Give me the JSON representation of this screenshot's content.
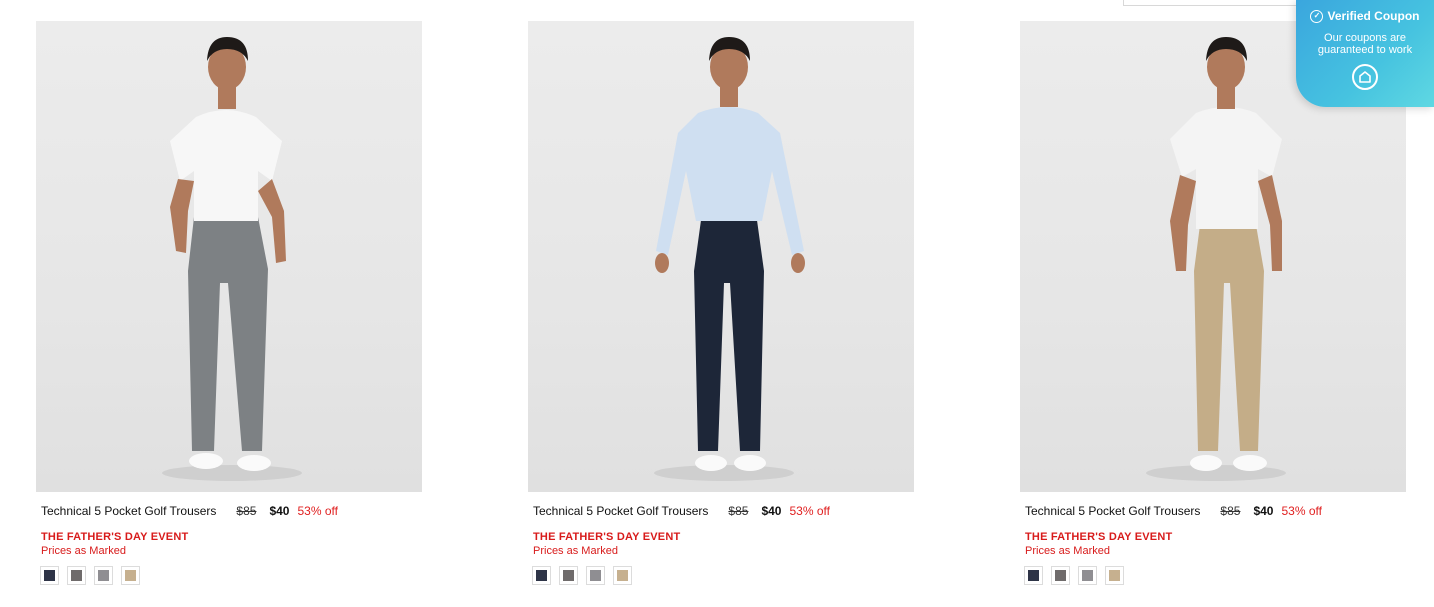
{
  "products": [
    {
      "title": "Technical 5 Pocket Golf Trousers",
      "was_price": "$85",
      "now_price": "$40",
      "discount": "53% off",
      "event": "THE FATHER'S DAY EVENT",
      "event_note": "Prices as Marked",
      "shirt_color": "#f7f7f7",
      "trouser_color": "#7d8184",
      "swatches": [
        "#2e3447",
        "#6f6b6b",
        "#8f8e92",
        "#c6b08f"
      ]
    },
    {
      "title": "Technical 5 Pocket Golf Trousers",
      "was_price": "$85",
      "now_price": "$40",
      "discount": "53% off",
      "event": "THE FATHER'S DAY EVENT",
      "event_note": "Prices as Marked",
      "shirt_color": "#cfdff1",
      "trouser_color": "#1d2638",
      "swatches": [
        "#2e3447",
        "#6f6b6b",
        "#8f8e92",
        "#c6b08f"
      ]
    },
    {
      "title": "Technical 5 Pocket Golf Trousers",
      "was_price": "$85",
      "now_price": "$40",
      "discount": "53% off",
      "event": "THE FATHER'S DAY EVENT",
      "event_note": "Prices as Marked",
      "shirt_color": "#f4f4f4",
      "trouser_color": "#c4ad88",
      "swatches": [
        "#2e3447",
        "#6f6b6b",
        "#8f8e92",
        "#c6b08f"
      ]
    }
  ],
  "coupon": {
    "title": "Verified Coupon",
    "text": "Our coupons are guaranteed to work",
    "check_icon": "check-circle-icon",
    "logo_icon": "coupon-logo-icon"
  }
}
